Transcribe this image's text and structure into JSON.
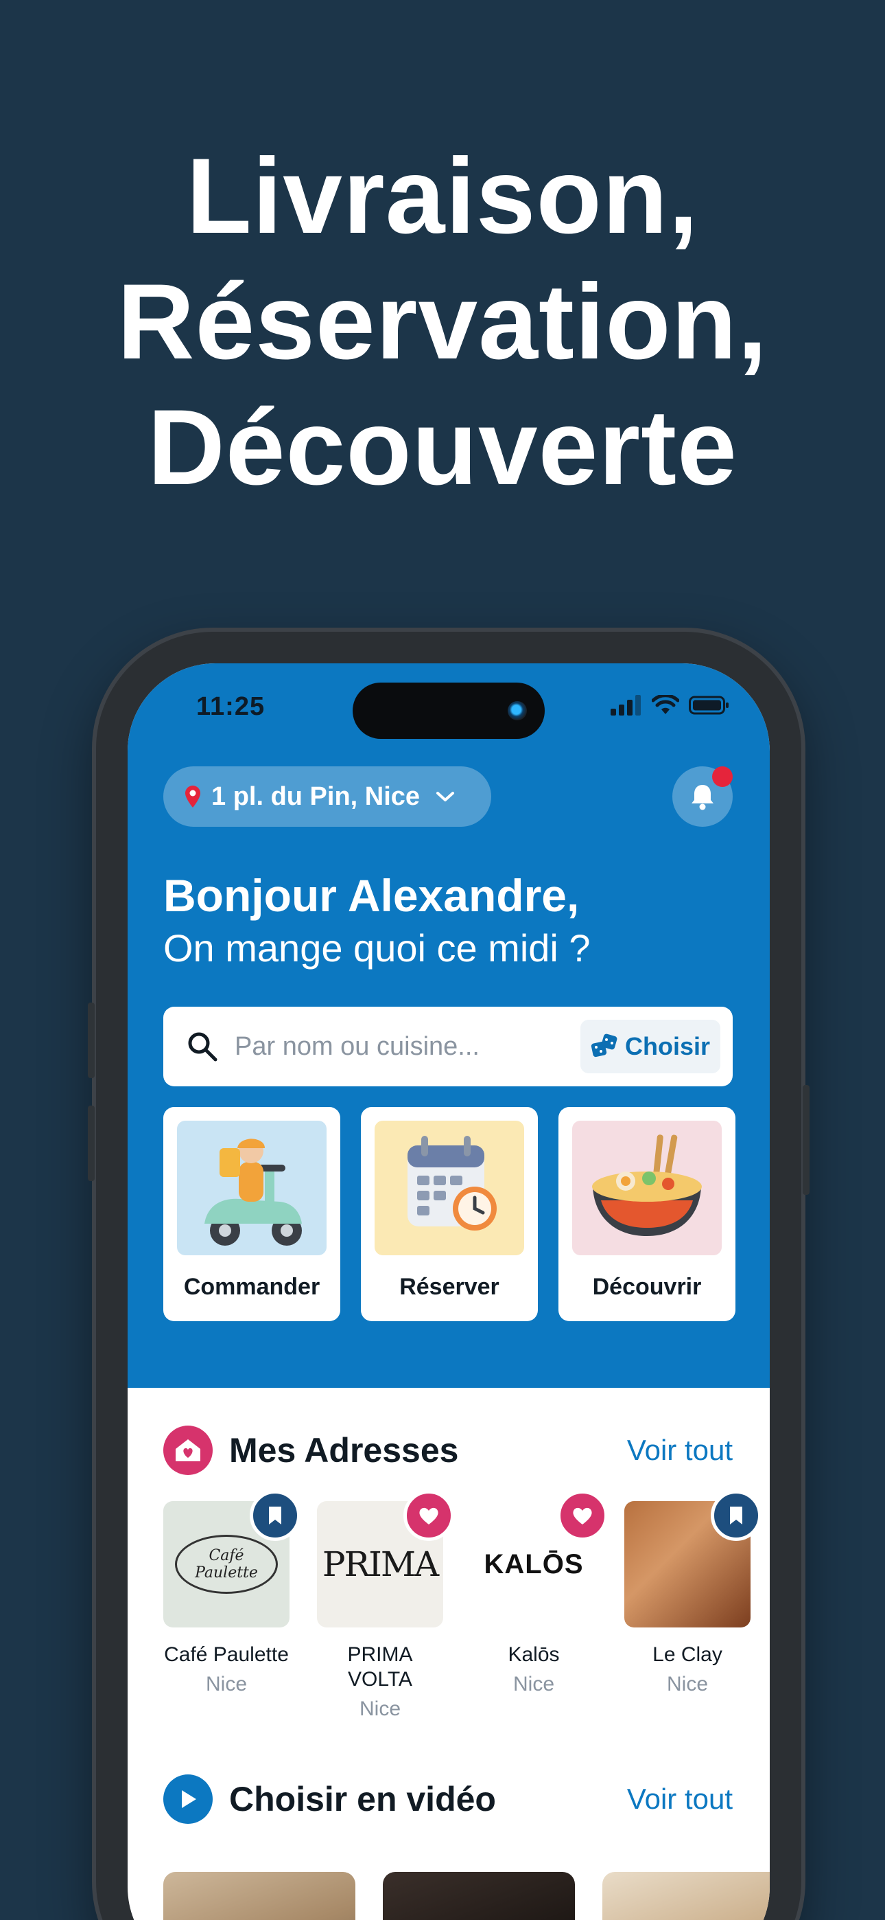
{
  "headline": {
    "line1": "Livraison,",
    "line2": "Réservation,",
    "line3": "Découverte"
  },
  "status_bar": {
    "time": "11:25"
  },
  "location": {
    "address": "1 pl. du Pin, Nice"
  },
  "greeting": {
    "title": "Bonjour Alexandre,",
    "subtitle": "On mange quoi ce midi ?"
  },
  "search": {
    "placeholder": "Par nom ou cuisine...",
    "choose_label": "Choisir"
  },
  "actions": [
    {
      "label": "Commander",
      "icon": "scooter-delivery-icon"
    },
    {
      "label": "Réserver",
      "icon": "calendar-clock-icon"
    },
    {
      "label": "Découvrir",
      "icon": "noodle-bowl-icon"
    }
  ],
  "addresses": {
    "title": "Mes Adresses",
    "see_all": "Voir tout",
    "items": [
      {
        "name": "Café Paulette",
        "city": "Nice",
        "logo_text": "Café Paulette",
        "badge": "bookmark"
      },
      {
        "name": "PRIMA VOLTA",
        "city": "Nice",
        "logo_text": "PRIMA",
        "badge": "heart"
      },
      {
        "name": "Kalōs",
        "city": "Nice",
        "logo_text": "KALŌS",
        "badge": "heart"
      },
      {
        "name": "Le Clay",
        "city": "Nice",
        "badge": "bookmark"
      }
    ]
  },
  "videos": {
    "title": "Choisir en vidéo",
    "see_all": "Voir tout"
  },
  "colors": {
    "background": "#1c3549",
    "brand_blue": "#0c78c1",
    "pink": "#d6336c",
    "navy": "#1d4e7e"
  }
}
